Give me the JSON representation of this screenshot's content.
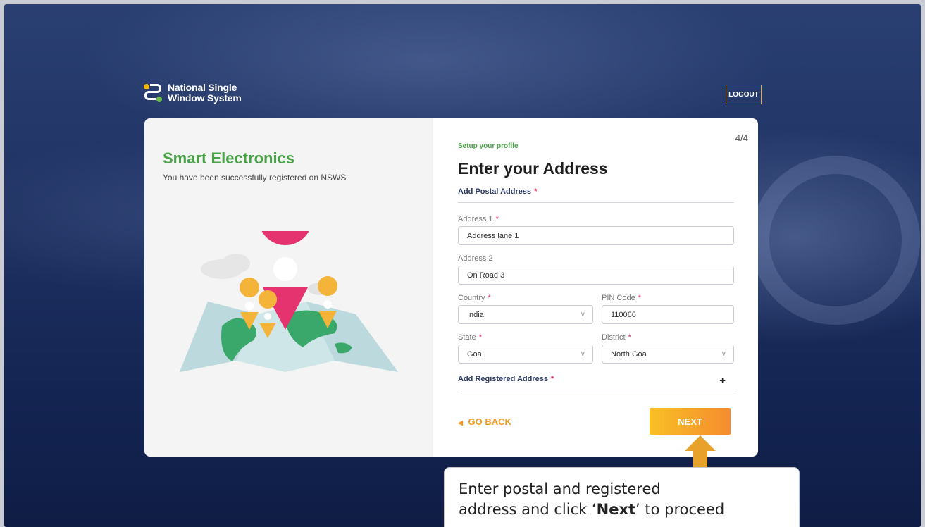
{
  "header": {
    "logo_line1": "National Single",
    "logo_line2": "Window System",
    "logout_label": "LOGOUT"
  },
  "left_panel": {
    "company_name": "Smart Electronics",
    "registration_message": "You have been successfully registered on NSWS"
  },
  "form": {
    "step": "4/4",
    "setup_label": "Setup your profile",
    "title": "Enter your Address",
    "postal_section_label": "Add Postal Address",
    "address1_label": "Address 1",
    "address1_value": "Address lane 1",
    "address2_label": "Address 2",
    "address2_value": "On Road 3",
    "country_label": "Country",
    "country_value": "India",
    "pin_label": "PIN Code",
    "pin_value": "110066",
    "state_label": "State",
    "state_value": "Goa",
    "district_label": "District",
    "district_value": "North Goa",
    "registered_section_label": "Add Registered Address",
    "required_mark": "*",
    "add_icon": "+",
    "go_back_label": "GO BACK",
    "next_label": "NEXT"
  },
  "callout": {
    "line1": "Enter postal and registered",
    "line2_pre": "address and click ‘",
    "line2_bold": "Next",
    "line2_post": "’ to proceed"
  },
  "colors": {
    "brand_green": "#47a345",
    "accent_orange": "#f29a1f",
    "background_navy": "#1d3060",
    "required_red": "#e0245e"
  }
}
